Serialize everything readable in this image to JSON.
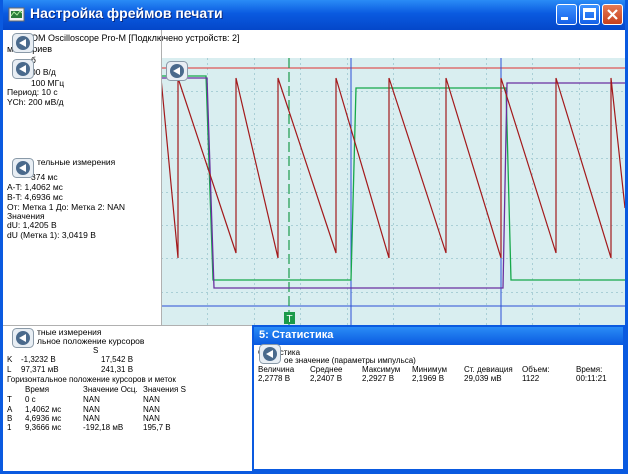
{
  "window": {
    "title": "Настройка фреймов печати"
  },
  "info_pane": {
    "device_line": "OM Oscilloscope Pro-M [Подключено устройств: 2]",
    "comments_label": "ментариев",
    "line_b": "б",
    "line_vdiv": "00 В/д",
    "line_freq": "100 МГц",
    "line_period": "Период: 10 с",
    "line_ych": "YCh: 200 мВ/д"
  },
  "meas_pane": {
    "header": "тельные измерения",
    "lines": [
      "374 мс",
      "A-T: 1,4062 мс",
      "B-T: 4,6936 мс",
      "От: Метка 1 До: Метка 2: NAN",
      "Значения",
      "dU: 1,4205 В",
      "dU (Метка 1): 3,0419 В"
    ]
  },
  "cursor_pane": {
    "header1": "тные измерения",
    "header2": "льное положение курсоров",
    "col_s": "S",
    "rows_top": [
      {
        "label": "K",
        "v1": "-1,3232 В",
        "v2": "17,542 В"
      },
      {
        "label": "L",
        "v1": "97,371 мВ",
        "v2": "241,31 В"
      }
    ],
    "horiz_header": "Горизонтальное положение курсоров и меток",
    "table_headers": [
      "Время",
      "Значение Осц.",
      "Значения S"
    ],
    "rows": [
      {
        "label": "T",
        "time": "0 с",
        "osc": "NAN",
        "s": "NAN"
      },
      {
        "label": "A",
        "time": "1,4062 мс",
        "osc": "NAN",
        "s": "NAN"
      },
      {
        "label": "B",
        "time": "4,6936 мс",
        "osc": "NAN",
        "s": "NAN"
      },
      {
        "label": "1",
        "time": "9,3666 мс",
        "osc": "-192,18 мВ",
        "s": "195,7 В"
      }
    ]
  },
  "stats": {
    "window_title": "5: Статистика",
    "section": "Статистика",
    "subsection": "ое значение (параметры импульса)",
    "headers": [
      "Величина",
      "Среднее",
      "Максимум",
      "Минимум",
      "Ст. девиация",
      "Объем:",
      "Время:"
    ],
    "values": [
      "2,2778 В",
      "2,2407 В",
      "2,2927 В",
      "2,1969 В",
      "29,039 мВ",
      "1122",
      "00:11:21"
    ]
  },
  "scope": {
    "trigger_marker": "T",
    "colors": {
      "background": "#d9eef0",
      "grid": "#a9cfd6",
      "sawtooth": "#a3191b",
      "green_trace": "#16a84a",
      "purple_trace": "#6a2fa0",
      "cursor_red": "#e03030",
      "cursor_blue": "#2b4fd6",
      "cursor_green": "#1b9a4a"
    }
  }
}
